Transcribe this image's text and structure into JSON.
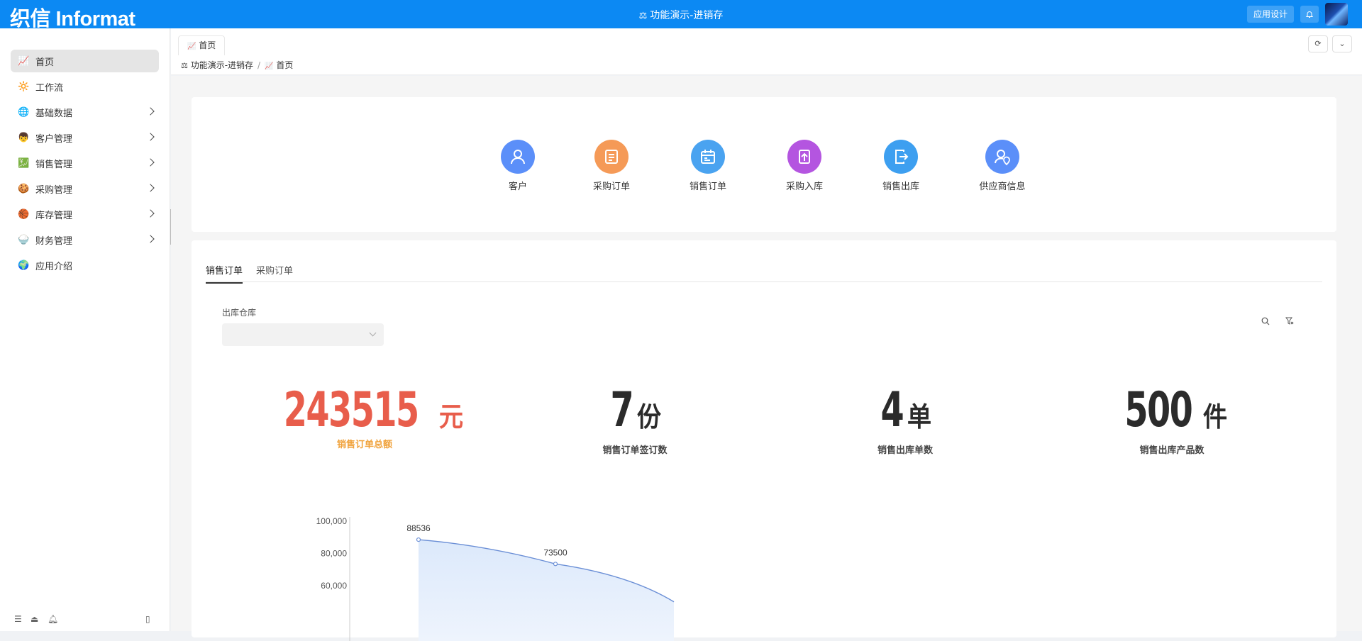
{
  "header": {
    "logo": "织信 Informat",
    "title": "功能演示-进销存",
    "title_icon": "⚖",
    "design_button": "应用设计",
    "bell_icon": "bell-icon",
    "colors": {
      "bar": "#0c89f3"
    }
  },
  "sidebar": {
    "items": [
      {
        "label": "首页",
        "icon": "📈",
        "active": true,
        "has_children": false
      },
      {
        "label": "工作流",
        "icon": "🔆",
        "active": false,
        "has_children": false
      },
      {
        "label": "基础数据",
        "icon": "🌐",
        "active": false,
        "has_children": true
      },
      {
        "label": "客户管理",
        "icon": "👦",
        "active": false,
        "has_children": true
      },
      {
        "label": "销售管理",
        "icon": "💹",
        "active": false,
        "has_children": true
      },
      {
        "label": "采购管理",
        "icon": "🍪",
        "active": false,
        "has_children": true
      },
      {
        "label": "库存管理",
        "icon": "🏀",
        "active": false,
        "has_children": true
      },
      {
        "label": "财务管理",
        "icon": "🍚",
        "active": false,
        "has_children": true
      },
      {
        "label": "应用介绍",
        "icon": "🌍",
        "active": false,
        "has_children": false
      }
    ],
    "bottom_icons": [
      "list-icon",
      "eject-icon",
      "bell-icon",
      "panel-icon"
    ]
  },
  "tabs": {
    "items": [
      {
        "label": "首页",
        "icon": "📈"
      }
    ]
  },
  "breadcrumb": {
    "items": [
      {
        "label": "功能演示-进销存",
        "icon": "⚖"
      },
      {
        "label": "首页",
        "icon": "📈"
      }
    ],
    "separator": "/"
  },
  "quick_access": {
    "items": [
      {
        "label": "客户",
        "color": "#5b8ff9",
        "icon": "user-icon"
      },
      {
        "label": "采购订单",
        "color": "#f59a57",
        "icon": "document-icon"
      },
      {
        "label": "销售订单",
        "color": "#4aa3f0",
        "icon": "calendar-icon"
      },
      {
        "label": "采购入库",
        "color": "#b455e0",
        "icon": "inbound-icon"
      },
      {
        "label": "销售出库",
        "color": "#3d9ff0",
        "icon": "outbound-icon"
      },
      {
        "label": "供应商信息",
        "color": "#5b8ff9",
        "icon": "user-location-icon"
      }
    ]
  },
  "dashboard": {
    "tabs": [
      "销售订单",
      "采购订单"
    ],
    "active_tab": 0,
    "filter": {
      "label": "出库仓库",
      "value": ""
    },
    "stats": [
      {
        "value": "243515",
        "unit": "元",
        "caption": "销售订单总额",
        "value_color": "#e85d4b",
        "caption_color": "#f0a23b"
      },
      {
        "value": "7",
        "unit": "份",
        "caption": "销售订单签订数",
        "value_color": "#2b2b2b",
        "caption_color": "#444444"
      },
      {
        "value": "4",
        "unit": "单",
        "caption": "销售出库单数",
        "value_color": "#2b2b2b",
        "caption_color": "#444444"
      },
      {
        "value": "500",
        "unit": "件",
        "caption": "销售出库产品数",
        "value_color": "#2b2b2b",
        "caption_color": "#444444"
      }
    ]
  },
  "chart_data": {
    "type": "area",
    "y_ticks": [
      "100,000",
      "80,000",
      "60,000"
    ],
    "ylim": [
      40000,
      100000
    ],
    "points": [
      {
        "x": 0,
        "y": 88536,
        "label": "88536"
      },
      {
        "x": 1,
        "y": 73500,
        "label": "73500"
      },
      {
        "x": 2,
        "y": 50000,
        "label": ""
      }
    ],
    "line_color": "#6b8fd6",
    "fill_color": "#dce9fb"
  }
}
